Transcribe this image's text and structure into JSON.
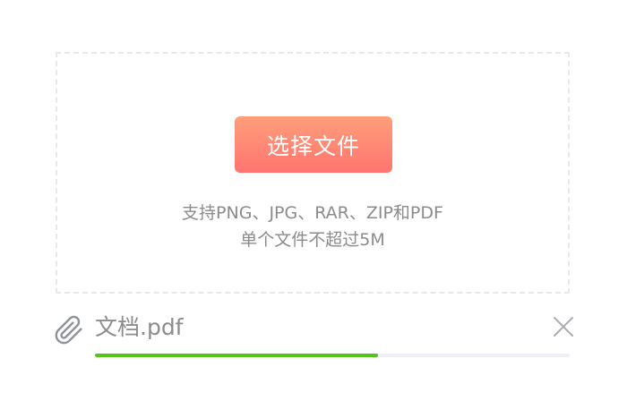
{
  "upload": {
    "button_label": "选择文件",
    "hint_line_1": "支持PNG、JPG、RAR、ZIP和PDF",
    "hint_line_2": "单个文件不超过5M"
  },
  "file": {
    "name": "文档.pdf",
    "progress": 0.597,
    "icons": {
      "attachment": "paperclip-icon",
      "remove": "close-icon"
    }
  },
  "colors": {
    "button_gradient_top": "#ff9e7a",
    "button_gradient_bottom": "#ff7470",
    "progress_fill": "#52c41a",
    "progress_track": "#eef0f6",
    "hint_text": "#8b8b8b",
    "dropzone_border": "#e6e8ee"
  }
}
